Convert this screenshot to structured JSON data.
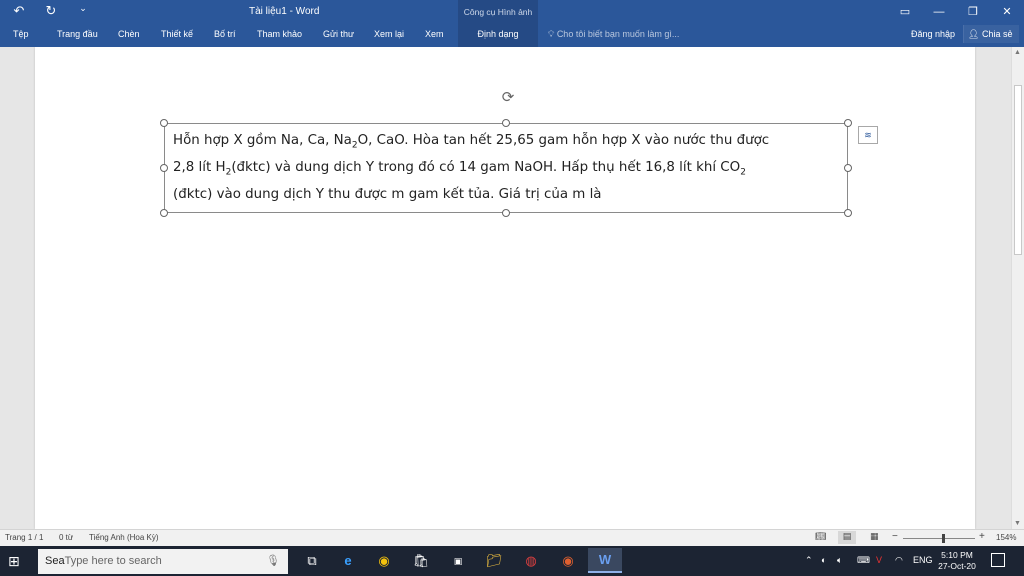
{
  "window": {
    "title": "Tài liệu1 - Word",
    "context_tab_group": "Công cụ Hình ảnh"
  },
  "ribbon": {
    "tabs": [
      "Tệp",
      "Trang đầu",
      "Chèn",
      "Thiết kế",
      "Bố trí",
      "Tham khảo",
      "Gửi thư",
      "Xem lại",
      "Xem"
    ],
    "context_tab": "Định dạng",
    "tell_me": "Cho tôi biết bạn muốn làm gì...",
    "sign_in": "Đăng nhập",
    "share": "Chia sẻ"
  },
  "document": {
    "line1_a": "Hỗn hợp X gồm Na, Ca, Na",
    "line1_sub": "2",
    "line1_b": "O, CaO. Hòa tan hết 25,65 gam hỗn hợp X vào nước thu được",
    "line2_a": "2,8 lít H",
    "line2_sub": "2",
    "line2_b": "(đktc) và dung dịch Y trong đó có 14 gam NaOH. Hấp thụ hết 16,8 lít khí CO",
    "line2_sub2": "2",
    "line3": "(đktc) vào dung dịch Y thu được m gam kết tủa. Giá trị của m là"
  },
  "status": {
    "page": "Trang 1 / 1",
    "words": "0 từ",
    "language": "Tiếng Anh (Hoa Kỳ)",
    "zoom": "154%"
  },
  "taskbar": {
    "search_placeholder": "Type here to search",
    "search_typed": "Sea",
    "language": "ENG",
    "time": "5:10 PM",
    "date": "27-Oct-20"
  }
}
